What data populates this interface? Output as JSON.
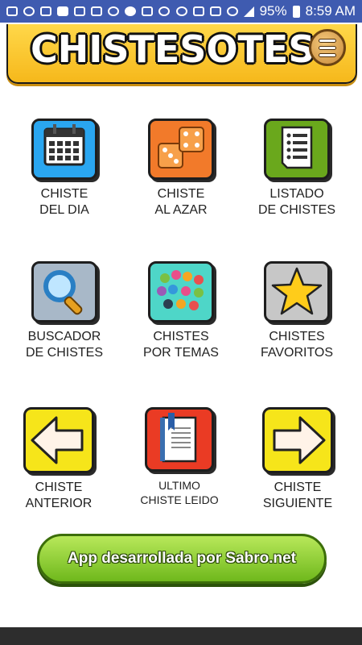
{
  "status_bar": {
    "battery": "95%",
    "time": "8:59 AM"
  },
  "app": {
    "title": "CHISTESOTES"
  },
  "tiles": [
    {
      "label": "CHISTE\nDEL DIA"
    },
    {
      "label": "CHISTE\nAL  AZAR"
    },
    {
      "label": "LISTADO\nDE CHISTES"
    },
    {
      "label": "BUSCADOR\nDE CHISTES"
    },
    {
      "label": "CHISTES\nPOR TEMAS"
    },
    {
      "label": "CHISTES\nFAVORITOS"
    },
    {
      "label": "CHISTE\nANTERIOR"
    },
    {
      "label": "ULTIMO\nCHISTE LEIDO"
    },
    {
      "label": "CHISTE\nSIGUIENTE"
    }
  ],
  "footer_button": {
    "label": "App desarrollada por Sabro.net"
  },
  "colors": {
    "status_bar": "#3f5bb0",
    "header": "#f6b81b",
    "cta": "#7cc426"
  }
}
